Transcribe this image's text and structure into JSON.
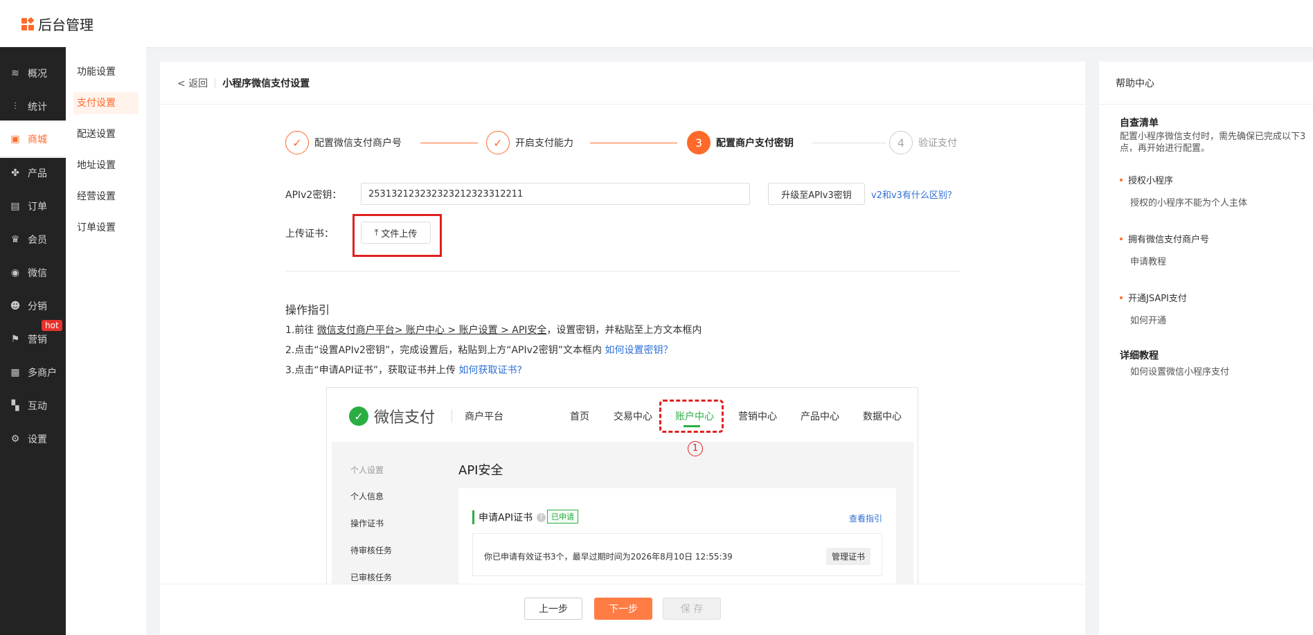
{
  "app": {
    "title": "后台管理"
  },
  "nav": {
    "items": [
      {
        "label": "概况",
        "icon": "layers-icon",
        "glyph": "≋"
      },
      {
        "label": "统计",
        "icon": "stats-icon",
        "glyph": "⫶"
      },
      {
        "label": "商城",
        "icon": "shop-icon",
        "glyph": "▣"
      },
      {
        "label": "产品",
        "icon": "product-icon",
        "glyph": "✤"
      },
      {
        "label": "订单",
        "icon": "order-icon",
        "glyph": "▤"
      },
      {
        "label": "会员",
        "icon": "crown-icon",
        "glyph": "♛"
      },
      {
        "label": "微信",
        "icon": "wechat-icon",
        "glyph": "◉"
      },
      {
        "label": "分销",
        "icon": "distribution-icon",
        "glyph": "☻"
      },
      {
        "label": "营销",
        "icon": "flag-icon",
        "glyph": "⚑"
      },
      {
        "label": "多商户",
        "icon": "merchant-icon",
        "glyph": "▦"
      },
      {
        "label": "互动",
        "icon": "interact-icon",
        "glyph": "▚"
      },
      {
        "label": "设置",
        "icon": "gear-icon",
        "glyph": "⚙"
      }
    ],
    "hot_badge": "hot"
  },
  "subnav": {
    "items": [
      "功能设置",
      "支付设置",
      "配送设置",
      "地址设置",
      "经营设置",
      "订单设置"
    ]
  },
  "main": {
    "back_label": "< 返回",
    "title": "小程序微信支付设置",
    "steps": [
      {
        "label": "配置微信支付商户号",
        "mark": "✓"
      },
      {
        "label": "开启支付能力",
        "mark": "✓"
      },
      {
        "label": "配置商户支付密钥",
        "mark": "3"
      },
      {
        "label": "验证支付",
        "mark": "4"
      }
    ],
    "api_label": "APIv2密钥：",
    "api_value": "253132123232323212323312211",
    "upgrade_button": "升级至APIv3密钥",
    "diff_link": "v2和v3有什么区别？",
    "upload_label": "上传证书：",
    "upload_button": "文件上传",
    "upload_icon": "⤒",
    "guide": {
      "title": "操作指引",
      "line1_prefix": "1.前往 ",
      "line1_link": "微信支付商户平台> 账户中心 > 账户设置 > API安全",
      "line1_suffix": "，设置密钥，并粘贴至上方文本框内",
      "line2_text": "2.点击“设置APIv2密钥”，完成设置后，粘贴到上方“APIv2密钥”文本框内 ",
      "line2_link": "如何设置密钥？",
      "line3_text": "3.点击“申请API证书”，获取证书并上传 ",
      "line3_link": "如何获取证书?"
    },
    "screenshot": {
      "brand": "微信支付",
      "platform": "商户平台",
      "nav": [
        "首页",
        "交易中心",
        "账户中心",
        "营销中心",
        "产品中心",
        "数据中心"
      ],
      "marker": "1",
      "side_items": [
        "个人设置",
        "个人信息",
        "操作证书",
        "待审核任务",
        "已审核任务"
      ],
      "api_title": "API安全",
      "card_title": "申请API证书",
      "card_badge": "已申请",
      "card_link": "查看指引",
      "card_text": "你已申请有效证书3个，最早过期时间为2026年8月10日 12:55:39",
      "manage_button": "管理证书"
    },
    "buttons": {
      "prev": "上一步",
      "next": "下一步",
      "save": "保 存"
    }
  },
  "help": {
    "title": "帮助中心",
    "checklist_title": "自查清单",
    "checklist_desc": "配置小程序微信支付时，需先确保已完成以下3点，再开始进行配置。",
    "items": [
      {
        "title": "授权小程序",
        "sub": "授权的小程序不能为个人主体"
      },
      {
        "title": "拥有微信支付商户号",
        "sub": "申请教程"
      },
      {
        "title": "开通JSAPI支付",
        "sub": "如何开通"
      }
    ],
    "tutorial_title": "详细教程",
    "tutorial_link": "如何设置微信小程序支付"
  },
  "colors": {
    "accent": "#ff6a2a",
    "sidebar": "#232323",
    "link": "#2c6fd6",
    "highlight": "#e02020",
    "wechat_green": "#2aae42"
  }
}
